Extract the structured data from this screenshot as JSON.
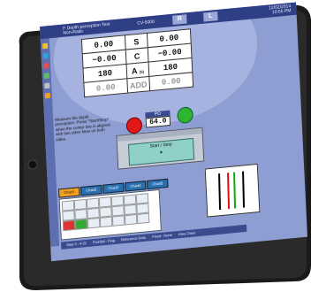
{
  "header": {
    "app_title": "F Depth perception Test",
    "subtitle": "Non-Ratio",
    "center_label": "CV-5000",
    "right_button": "R",
    "left_button": "L",
    "date": "12/02/2014",
    "time": "10:55 PM"
  },
  "rx_table": {
    "rows": [
      {
        "right": "0.00",
        "label": "S",
        "left": "0.00"
      },
      {
        "right": "−0.00",
        "label": "C",
        "left": "−0.00"
      },
      {
        "right": "180",
        "label": "A",
        "note": "(S)",
        "left": "180"
      },
      {
        "right": "0.00",
        "label": "ADD",
        "left": "0.00"
      }
    ]
  },
  "instruction": "Measure the depth perception. Press \"Start/Stop\" when the center line is aligned with two other lines on both sides.",
  "pd": {
    "label": "PD",
    "value": "64.0"
  },
  "start_stop": {
    "label": "Start / Stop"
  },
  "tabs": [
    "Chart1",
    "Chart2",
    "Chart3",
    "Chart4",
    "Chart5"
  ],
  "status_bar": [
    "Step 3 : 4-21",
    "Prohibit : Flag",
    "Reference Data",
    "Fixed : None",
    "Area Ones"
  ],
  "colors": {
    "screen_bg": "#8f9ed2",
    "accent_red": "#e01818",
    "accent_green": "#2fb52f",
    "title_bar": "#2f3f86",
    "tab_selected": "#f0a020"
  },
  "stimulus": {
    "lines": [
      "black",
      "red",
      "green",
      "black"
    ]
  }
}
